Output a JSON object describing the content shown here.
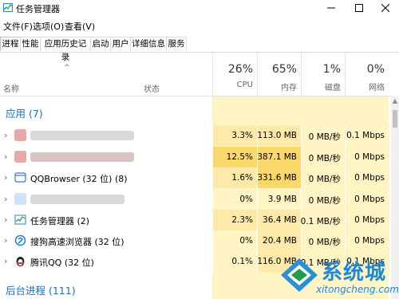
{
  "window": {
    "title": "任务管理器"
  },
  "menu": [
    "文件(F)",
    "选项(O)",
    "查看(V)"
  ],
  "tabs": [
    "进程",
    "性能",
    "应用历史记录",
    "启动",
    "用户",
    "详细信息",
    "服务"
  ],
  "active_tab": 0,
  "columns": {
    "name": "名称",
    "status": "状态",
    "cpu": {
      "pct": "26%",
      "label": "CPU"
    },
    "memory": {
      "pct": "65%",
      "label": "内存"
    },
    "disk": {
      "pct": "1%",
      "label": "磁盘"
    },
    "network": {
      "pct": "0%",
      "label": "网络"
    }
  },
  "groups": {
    "apps": "应用 (7)",
    "background": "后台进程 (111)"
  },
  "rows": [
    {
      "name": "",
      "cpu": "3.3%",
      "mem": "113.0 MB",
      "disk": "0 MB/秒",
      "net": "0.1 Mbps",
      "icon": "blurred-app-icon"
    },
    {
      "name": "",
      "cpu": "12.5%",
      "mem": "387.1 MB",
      "disk": "0 MB/秒",
      "net": "0 Mbps",
      "icon": "blurred-app-icon"
    },
    {
      "name": "QQBrowser (32 位) (8)",
      "cpu": "1.6%",
      "mem": "331.6 MB",
      "disk": "0 MB/秒",
      "net": "0 Mbps",
      "icon": "browser-icon"
    },
    {
      "name": "",
      "cpu": "0%",
      "mem": "3.9 MB",
      "disk": "0 MB/秒",
      "net": "0 Mbps",
      "icon": "blurred-app-icon"
    },
    {
      "name": "任务管理器 (2)",
      "cpu": "2.3%",
      "mem": "36.4 MB",
      "disk": "0.1 MB/秒",
      "net": "0 Mbps",
      "icon": "task-manager-icon"
    },
    {
      "name": "搜狗高速浏览器 (32 位)",
      "cpu": "0%",
      "mem": "20.4 MB",
      "disk": "0 MB/秒",
      "net": "0 Mbps",
      "icon": "sogou-browser-icon"
    },
    {
      "name": "腾讯QQ (32 位)",
      "cpu": "0.1%",
      "mem": "116.0 MB",
      "disk": "0.1 MB/秒",
      "net": "0.1 Mbps",
      "icon": "qq-penguin-icon"
    }
  ],
  "watermark": {
    "name": "系统城",
    "url": "xitongcheng.com"
  },
  "colors": {
    "heat_light": "#fff4c4",
    "heat_medium": "#fde9a8",
    "heat_strong": "#fad869",
    "group_blue": "#1e6dbf"
  }
}
